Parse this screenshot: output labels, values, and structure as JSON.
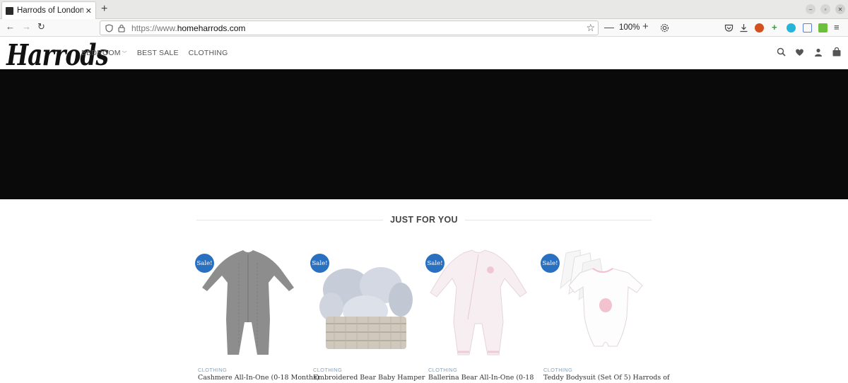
{
  "browser": {
    "tab_title": "Harrods of London | Buy",
    "new_tab": "+",
    "url_prefix": "https://www.",
    "url_domain": "homeharrods.com",
    "zoom": "100%"
  },
  "site": {
    "logo": "Harrods",
    "nav": [
      {
        "label": "BEDROOM",
        "has_dropdown": true
      },
      {
        "label": "BEST SALE"
      },
      {
        "label": "CLOTHING"
      }
    ]
  },
  "section": {
    "title": "JUST FOR YOU"
  },
  "products": [
    {
      "badge": "Sale!",
      "category": "CLOTHING",
      "name": "Cashmere All-In-One (0-18 Months)",
      "image": "grey-knit-onesie"
    },
    {
      "badge": "Sale!",
      "category": "CLOTHING",
      "name": "Embroidered Bear Baby Hamper",
      "image": "baby-gift-basket"
    },
    {
      "badge": "Sale!",
      "category": "CLOTHING",
      "name": "Ballerina Bear All-In-One (0-18",
      "image": "pink-sleepsuit"
    },
    {
      "badge": "Sale!",
      "category": "CLOTHING",
      "name": "Teddy Bodysuit (Set Of 5) Harrods of",
      "image": "bodysuit-set"
    }
  ],
  "colors": {
    "hero": "#0a0a0a",
    "badge": "#2a70c0",
    "category": "#7fa7c8"
  }
}
